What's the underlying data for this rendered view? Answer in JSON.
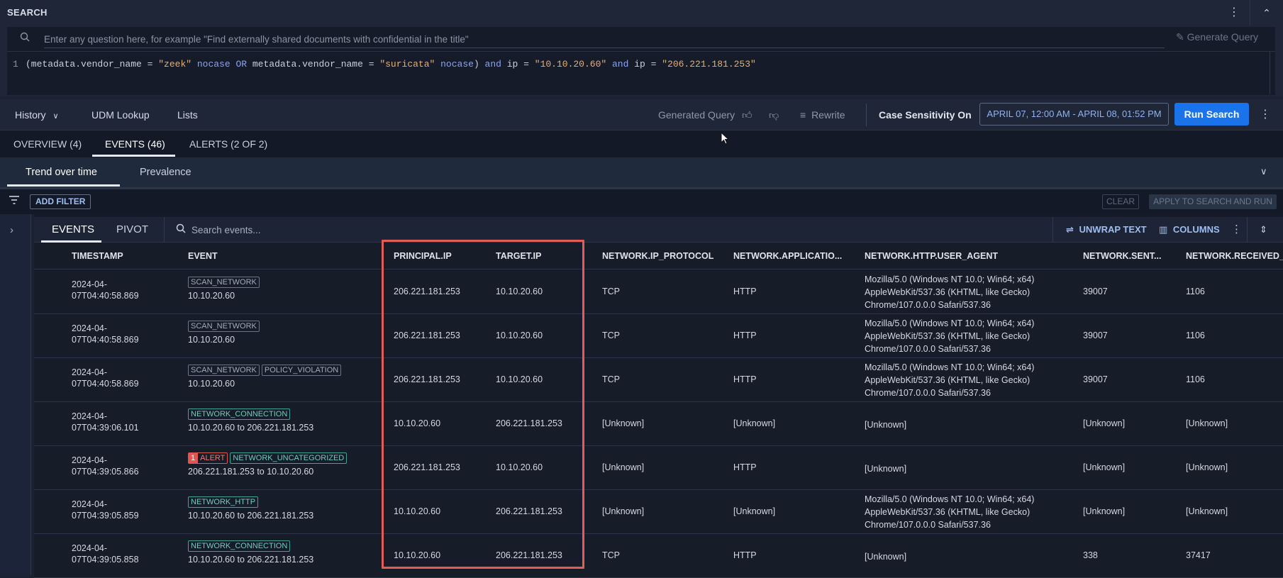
{
  "search": {
    "label": "SEARCH",
    "question_placeholder": "Enter any question here, for example \"Find externally shared documents with confidential in the title\"",
    "generate_query": "Generate Query",
    "query_line_number": "1",
    "query_parts": [
      {
        "t": "(metadata.vendor_name = ",
        "c": "op"
      },
      {
        "t": "\"zeek\"",
        "c": "str"
      },
      {
        "t": " nocase ",
        "c": "kw"
      },
      {
        "t": "OR",
        "c": "kw"
      },
      {
        "t": " metadata.vendor_name = ",
        "c": "op"
      },
      {
        "t": "\"suricata\"",
        "c": "str"
      },
      {
        "t": " nocase",
        "c": "kw"
      },
      {
        "t": ") ",
        "c": "op"
      },
      {
        "t": "and",
        "c": "kw"
      },
      {
        "t": " ip = ",
        "c": "op"
      },
      {
        "t": "\"10.10.20.60\"",
        "c": "str"
      },
      {
        "t": " ",
        "c": "op"
      },
      {
        "t": "and",
        "c": "kw"
      },
      {
        "t": " ip = ",
        "c": "op"
      },
      {
        "t": "\"206.221.181.253\"",
        "c": "str"
      }
    ]
  },
  "toolbar": {
    "history": "History",
    "udm_lookup": "UDM Lookup",
    "lists": "Lists",
    "generated_query": "Generated Query",
    "rewrite": "Rewrite",
    "case_sensitivity": "Case Sensitivity On",
    "date_range": "APRIL 07, 12:00 AM - APRIL 08, 01:52 PM",
    "run_search": "Run Search"
  },
  "results_tabs": {
    "overview": "OVERVIEW (4)",
    "events": "EVENTS (46)",
    "alerts": "ALERTS (2 OF 2)"
  },
  "view_tabs": {
    "trend": "Trend over time",
    "prevalence": "Prevalence"
  },
  "filters": {
    "add_filter": "ADD FILTER",
    "clear": "CLEAR",
    "apply": "APPLY TO SEARCH AND RUN"
  },
  "events_panel": {
    "tab_events": "EVENTS",
    "tab_pivot": "PIVOT",
    "search_placeholder": "Search events...",
    "unwrap_text": "UNWRAP TEXT",
    "columns": "COLUMNS"
  },
  "columns": {
    "timestamp": "TIMESTAMP",
    "event": "EVENT",
    "principal_ip": "PRINCIPAL.IP",
    "target_ip": "TARGET.IP",
    "ip_protocol": "NETWORK.IP_PROTOCOL",
    "application": "NETWORK.APPLICATIO...",
    "user_agent": "NETWORK.HTTP.USER_AGENT",
    "sent": "NETWORK.SENT...",
    "received": "NETWORK.RECEIVED_E"
  },
  "rows": [
    {
      "ts1": "2024-04-",
      "ts2": "07T04:40:58.869",
      "tags": [
        {
          "label": "SCAN_NETWORK",
          "kind": "plain"
        }
      ],
      "desc": "10.10.20.60",
      "principal_ip": "206.221.181.253",
      "target_ip": "10.10.20.60",
      "protocol": "TCP",
      "application": "HTTP",
      "ua": "Mozilla/5.0 (Windows NT 10.0; Win64; x64) AppleWebKit/537.36 (KHTML, like Gecko) Chrome/107.0.0.0 Safari/537.36",
      "sent": "39007",
      "received": "1106"
    },
    {
      "ts1": "2024-04-",
      "ts2": "07T04:40:58.869",
      "tags": [
        {
          "label": "SCAN_NETWORK",
          "kind": "plain"
        }
      ],
      "desc": "10.10.20.60",
      "principal_ip": "206.221.181.253",
      "target_ip": "10.10.20.60",
      "protocol": "TCP",
      "application": "HTTP",
      "ua": "Mozilla/5.0 (Windows NT 10.0; Win64; x64) AppleWebKit/537.36 (KHTML, like Gecko) Chrome/107.0.0.0 Safari/537.36",
      "sent": "39007",
      "received": "1106"
    },
    {
      "ts1": "2024-04-",
      "ts2": "07T04:40:58.869",
      "tags": [
        {
          "label": "SCAN_NETWORK",
          "kind": "plain"
        },
        {
          "label": "POLICY_VIOLATION",
          "kind": "plain"
        }
      ],
      "desc": "10.10.20.60",
      "principal_ip": "206.221.181.253",
      "target_ip": "10.10.20.60",
      "protocol": "TCP",
      "application": "HTTP",
      "ua": "Mozilla/5.0 (Windows NT 10.0; Win64; x64) AppleWebKit/537.36 (KHTML, like Gecko) Chrome/107.0.0.0 Safari/537.36",
      "sent": "39007",
      "received": "1106"
    },
    {
      "ts1": "2024-04-",
      "ts2": "07T04:39:06.101",
      "tags": [
        {
          "label": "NETWORK_CONNECTION",
          "kind": "net"
        }
      ],
      "desc": "10.10.20.60 to 206.221.181.253",
      "principal_ip": "10.10.20.60",
      "target_ip": "206.221.181.253",
      "protocol": "[Unknown]",
      "application": "[Unknown]",
      "ua": "[Unknown]",
      "sent": "[Unknown]",
      "received": "[Unknown]"
    },
    {
      "ts1": "2024-04-",
      "ts2": "07T04:39:05.866",
      "alert_count": "1",
      "tags": [
        {
          "label": "ALERT",
          "kind": "alert"
        },
        {
          "label": "NETWORK_UNCATEGORIZED",
          "kind": "net"
        }
      ],
      "desc": "206.221.181.253 to 10.10.20.60",
      "principal_ip": "206.221.181.253",
      "target_ip": "10.10.20.60",
      "protocol": "[Unknown]",
      "application": "HTTP",
      "ua": "[Unknown]",
      "sent": "[Unknown]",
      "received": "[Unknown]"
    },
    {
      "ts1": "2024-04-",
      "ts2": "07T04:39:05.859",
      "tags": [
        {
          "label": "NETWORK_HTTP",
          "kind": "net"
        }
      ],
      "desc": "10.10.20.60 to 206.221.181.253",
      "principal_ip": "10.10.20.60",
      "target_ip": "206.221.181.253",
      "protocol": "[Unknown]",
      "application": "[Unknown]",
      "ua": "Mozilla/5.0 (Windows NT 10.0; Win64; x64) AppleWebKit/537.36 (KHTML, like Gecko) Chrome/107.0.0.0 Safari/537.36",
      "sent": "[Unknown]",
      "received": "[Unknown]"
    },
    {
      "ts1": "2024-04-",
      "ts2": "07T04:39:05.858",
      "tags": [
        {
          "label": "NETWORK_CONNECTION",
          "kind": "net"
        }
      ],
      "desc": "10.10.20.60 to 206.221.181.253",
      "principal_ip": "10.10.20.60",
      "target_ip": "206.221.181.253",
      "protocol": "TCP",
      "application": "HTTP",
      "ua": "[Unknown]",
      "sent": "338",
      "received": "37417"
    }
  ],
  "icons": {
    "search": "search-icon",
    "generate": "magic-wand-icon",
    "more": "more-vert-icon",
    "collapse": "chevron-up-icon",
    "thumb_up": "thumb-up-icon",
    "thumb_down": "thumb-down-icon",
    "rewrite": "rewrite-icon",
    "filter": "filter-icon",
    "expand": "chevron-right-icon",
    "unwrap": "wrap-text-icon",
    "columns": "columns-icon"
  },
  "colors": {
    "accent": "#1a73e8",
    "highlight": "#e25c58",
    "network_tag": "#3fa39a",
    "alert_tag": "#e0554f"
  }
}
